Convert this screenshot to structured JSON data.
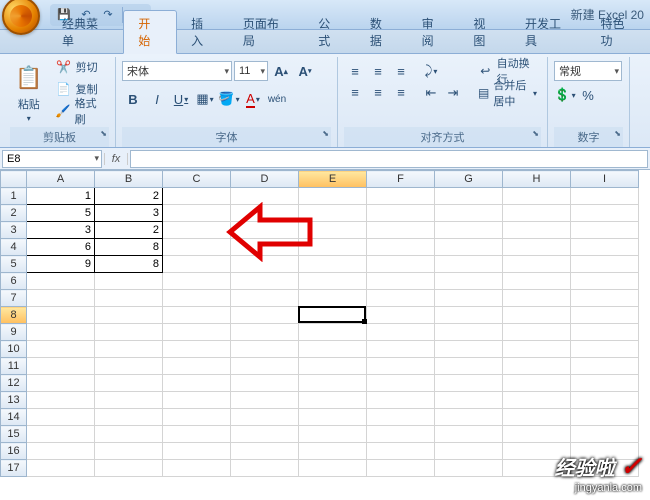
{
  "title": "新建 Excel 20",
  "tabs": [
    "经典菜单",
    "开始",
    "插入",
    "页面布局",
    "公式",
    "数据",
    "审阅",
    "视图",
    "开发工具",
    "特色功"
  ],
  "active_tab": 1,
  "clipboard": {
    "paste": "粘贴",
    "cut": "剪切",
    "copy": "复制",
    "format_painter": "格式刷",
    "label": "剪贴板"
  },
  "font": {
    "name": "宋体",
    "size": "11",
    "label": "字体",
    "bold": "B",
    "italic": "I",
    "underline": "U"
  },
  "alignment": {
    "wrap": "自动换行",
    "merge": "合并后居中",
    "label": "对齐方式"
  },
  "number": {
    "style": "常规",
    "label": "数字"
  },
  "name_box": "E8",
  "fx": "fx",
  "columns": [
    "A",
    "B",
    "C",
    "D",
    "E",
    "F",
    "G",
    "H",
    "I"
  ],
  "rows": 17,
  "selected_col": "E",
  "selected_row": 8,
  "cells": {
    "A1": "1",
    "B1": "2",
    "A2": "5",
    "B2": "3",
    "A3": "3",
    "B3": "2",
    "A4": "6",
    "B4": "8",
    "A5": "9",
    "B5": "8"
  },
  "watermark": {
    "line1": "经验啦",
    "line2": "jingyanla.com"
  }
}
